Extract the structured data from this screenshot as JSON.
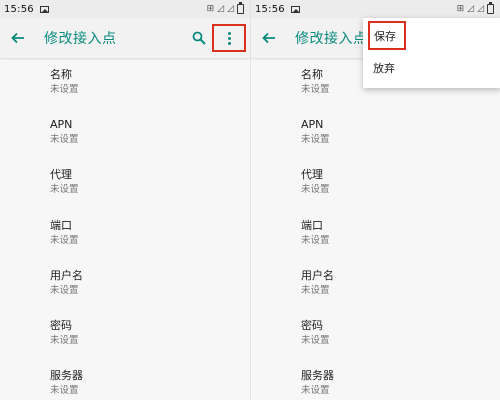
{
  "colors": {
    "accent": "#0a8a7d",
    "highlight": "#d9301f",
    "background": "#f7f7f7"
  },
  "status_bar": {
    "time": "15:56"
  },
  "screen": {
    "title": "修改接入点"
  },
  "fields": [
    {
      "label": "名称",
      "value": "未设置"
    },
    {
      "label": "APN",
      "value": "未设置"
    },
    {
      "label": "代理",
      "value": "未设置"
    },
    {
      "label": "端口",
      "value": "未设置"
    },
    {
      "label": "用户名",
      "value": "未设置"
    },
    {
      "label": "密码",
      "value": "未设置"
    },
    {
      "label": "服务器",
      "value": "未设置"
    }
  ],
  "overflow_menu": {
    "items": [
      {
        "label": "保存"
      },
      {
        "label": "放弃"
      }
    ]
  },
  "icons": {
    "back": "arrow-left-icon",
    "search": "search-icon",
    "more": "more-vertical-icon"
  }
}
